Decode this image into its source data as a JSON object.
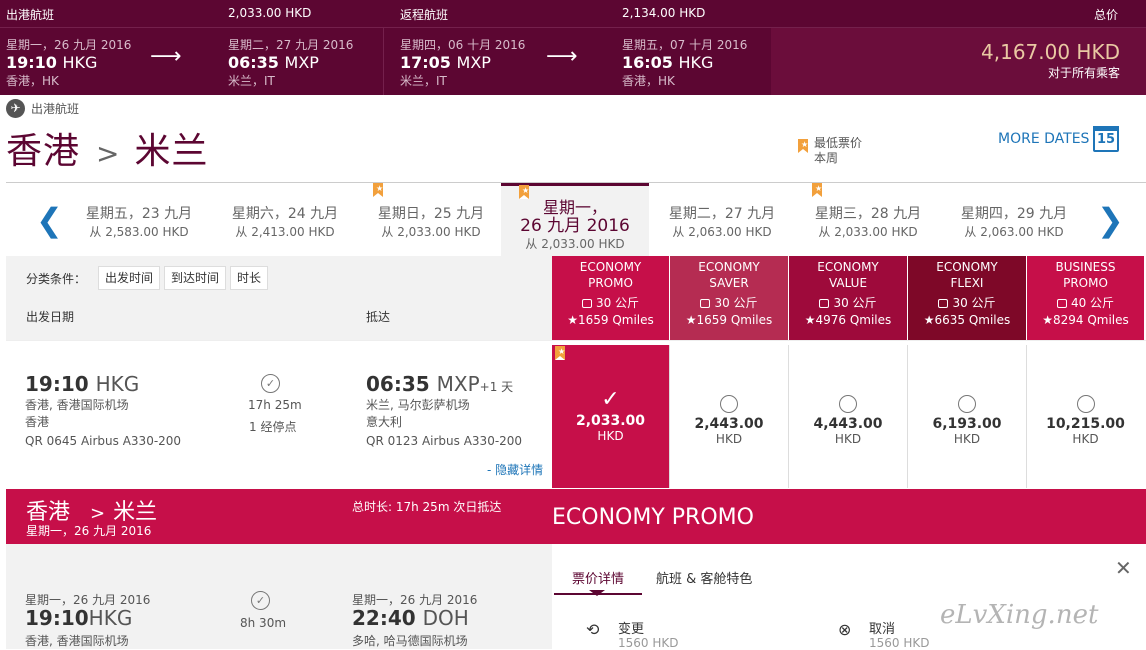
{
  "summary": {
    "outbound_label": "出港航班",
    "outbound_price": "2,033.00 HKD",
    "return_label": "返程航班",
    "return_price": "2,134.00 HKD",
    "total_label": "总价",
    "total_price": "4,167.00 HKD",
    "total_note": "对于所有乘客",
    "seg1": {
      "dep_date": "星期一，26 九月 2016",
      "dep_time": "19:10",
      "dep_code": "HKG",
      "dep_city": "香港，HK",
      "arr_date": "星期二，27 九月 2016",
      "arr_time": "06:35",
      "arr_code": "MXP",
      "arr_city": "米兰，IT"
    },
    "seg2": {
      "dep_date": "星期四，06 十月 2016",
      "dep_time": "17:05",
      "dep_code": "MXP",
      "dep_city": "米兰，IT",
      "arr_date": "星期五，07 十月 2016",
      "arr_time": "16:05",
      "arr_code": "HKG",
      "arr_city": "香港，HK"
    }
  },
  "section": {
    "label": "出港航班",
    "from": "香港",
    "to": "米兰",
    "lowest_label": "最低票价",
    "lowest_sub": "本周",
    "more_dates": "MORE DATES",
    "calendar_day": "15"
  },
  "dates": [
    {
      "day": "星期五，23 九月",
      "price": "从 2,583.00 HKD"
    },
    {
      "day": "星期六，24 九月",
      "price": "从 2,413.00 HKD"
    },
    {
      "day": "星期日，25 九月",
      "price": "从 2,033.00 HKD"
    },
    {
      "day": "星期一，",
      "day2": "26 九月 2016",
      "price": "从 2,033.00 HKD"
    },
    {
      "day": "星期二，27 九月",
      "price": "从 2,063.00 HKD"
    },
    {
      "day": "星期三，28 九月",
      "price": "从 2,033.00 HKD"
    },
    {
      "day": "星期四，29 九月",
      "price": "从 2,063.00 HKD"
    }
  ],
  "filters": {
    "label": "分类条件：",
    "btn1": "出发时间",
    "btn2": "到达时间",
    "btn3": "时长",
    "col_depart": "出发日期",
    "col_arrive": "抵达"
  },
  "fares": [
    {
      "name": "ECONOMY\nPROMO",
      "weight": "30 公斤",
      "qmiles": "★1659 Qmiles",
      "color": "#c60f49"
    },
    {
      "name": "ECONOMY\nSAVER",
      "weight": "30 公斤",
      "qmiles": "★1659 Qmiles",
      "color": "#b52c52"
    },
    {
      "name": "ECONOMY\nVALUE",
      "weight": "30 公斤",
      "qmiles": "★4976 Qmiles",
      "color": "#9e0a3b"
    },
    {
      "name": "ECONOMY\nFLEXI",
      "weight": "30 公斤",
      "qmiles": "★6635 Qmiles",
      "color": "#7e0828"
    },
    {
      "name": "BUSINESS\nPROMO",
      "weight": "40 公斤",
      "qmiles": "★8294 Qmiles",
      "color": "#c60f49"
    }
  ],
  "flight": {
    "dep_time": "19:10",
    "dep_code": "HKG",
    "dep_airport": "香港, 香港国际机场",
    "dep_country": "香港",
    "flight_no": "QR 0645 Airbus A330-200",
    "duration": "17h 25m",
    "stops": "1 经停点",
    "arr_time": "06:35",
    "arr_code": "MXP",
    "plus_day": "+1 天",
    "arr_airport": "米兰, 马尔彭萨机场",
    "arr_country": "意大利",
    "arr_flight_no": "QR 0123 Airbus A330-200",
    "hide": "- 隐藏详情",
    "prices": [
      {
        "amount": "2,033.00",
        "cur": "HKD"
      },
      {
        "amount": "2,443.00",
        "cur": "HKD"
      },
      {
        "amount": "4,443.00",
        "cur": "HKD"
      },
      {
        "amount": "6,193.00",
        "cur": "HKD"
      },
      {
        "amount": "10,215.00",
        "cur": "HKD"
      }
    ]
  },
  "details": {
    "from": "香港",
    "to": "米兰",
    "date": "星期一，26 九月 2016",
    "duration": "总时长: 17h 25m 次日抵达",
    "fare_name": "ECONOMY PROMO",
    "leg_dep_date": "星期一，26 九月 2016",
    "leg_dep_time": "19:10",
    "leg_dep_code": "HKG",
    "leg_dep_airport": "香港, 香港国际机场",
    "leg_dur": "8h 30m",
    "leg_arr_date": "星期一，26 九月 2016",
    "leg_arr_time": "22:40",
    "leg_arr_code": "DOH",
    "leg_arr_airport": "多哈, 哈马德国际机场",
    "tab1": "票价详情",
    "tab2": "航班 & 客舱特色",
    "change_label": "变更",
    "change_fee": "1560 HKD",
    "cancel_label": "取消",
    "cancel_fee": "1560 HKD"
  },
  "watermark": "eLvXing.net"
}
